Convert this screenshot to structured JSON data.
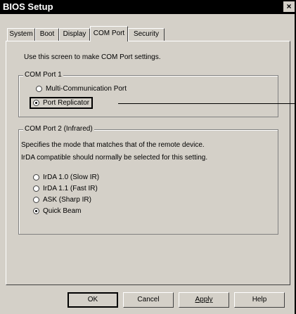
{
  "window": {
    "title": "BIOS Setup",
    "close_glyph": "×"
  },
  "tabs": [
    {
      "label": "System"
    },
    {
      "label": "Boot"
    },
    {
      "label": "Display"
    },
    {
      "label": "COM Port"
    },
    {
      "label": "Security"
    }
  ],
  "active_tab": "COM Port",
  "intro_text": "Use this screen to make COM Port settings.",
  "com_port_1": {
    "legend": "COM Port 1",
    "options": [
      {
        "label": "Multi-Communication Port",
        "checked": false
      },
      {
        "label": "Port Replicator",
        "checked": true
      }
    ]
  },
  "com_port_2": {
    "legend": "COM Port 2 (Infrared)",
    "desc_line1": "Specifies the mode that matches that of the remote device.",
    "desc_line2": "IrDA compatible should normally be selected for this setting.",
    "options": [
      {
        "label": "IrDA 1.0 (Slow IR)",
        "checked": false
      },
      {
        "label": "IrDA 1.1 (Fast IR)",
        "checked": false
      },
      {
        "label": "ASK (Sharp IR)",
        "checked": false
      },
      {
        "label": "Quick Beam",
        "checked": true
      }
    ]
  },
  "buttons": {
    "ok": "OK",
    "cancel": "Cancel",
    "apply": "Apply",
    "help": "Help"
  }
}
